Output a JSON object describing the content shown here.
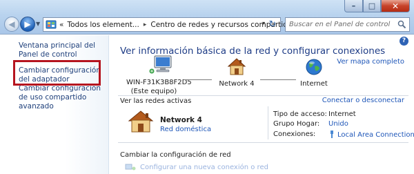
{
  "window": {
    "minimize_glyph": "–",
    "maximize_glyph": "□",
    "close_glyph": "✕"
  },
  "address_bar": {
    "overflow_glyph": "«",
    "segments": [
      "Todos los element...",
      "Centro de redes y recursos compartidos"
    ],
    "separator": "▸",
    "dropdown_glyph": "▾",
    "refresh_glyph": "↻"
  },
  "search": {
    "placeholder": "Buscar en el Panel de control",
    "icon": "search-icon"
  },
  "sidebar": {
    "items": [
      {
        "label": "Ventana principal del Panel de control"
      },
      {
        "label": "Cambiar configuración del adaptador",
        "highlighted": true
      },
      {
        "label": "Cambiar configuración de uso compartido avanzado"
      }
    ],
    "highlight_color": "#b5141f"
  },
  "main": {
    "help_glyph": "?",
    "heading": "Ver información básica de la red y configurar conexiones",
    "map_link": "Ver mapa completo",
    "nodes": [
      {
        "label": "WIN-F31K3B8F2D5",
        "sublabel": "(Este equipo)",
        "icon": "computer-icon"
      },
      {
        "label": "Network  4",
        "icon": "house-icon"
      },
      {
        "label": "Internet",
        "icon": "globe-icon"
      }
    ],
    "active_networks_title": "Ver las redes activas",
    "connect_link": "Conectar o desconectar",
    "network": {
      "name": "Network  4",
      "type": "Red doméstica",
      "props": [
        {
          "key": "Tipo de acceso:",
          "value": "Internet",
          "link": false
        },
        {
          "key": "Grupo Hogar:",
          "value": "Unido",
          "link": true
        },
        {
          "key": "Conexiones:",
          "value": "Local Area Connection",
          "link": true
        }
      ]
    },
    "change_settings_title": "Cambiar la configuración de red",
    "setup_link": "Configurar una nueva conexión o red"
  }
}
